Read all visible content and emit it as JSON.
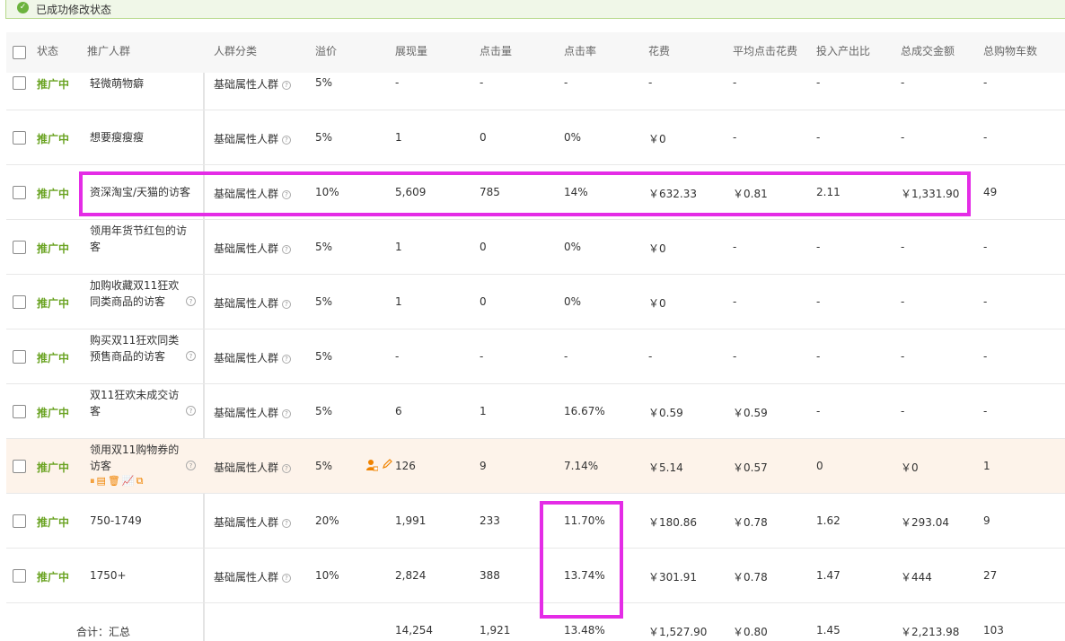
{
  "banner": {
    "message": "已成功修改状态"
  },
  "table": {
    "headers": {
      "status": "状态",
      "crowd": "推广人群",
      "category": "人群分类",
      "premium": "溢价",
      "impressions": "展现量",
      "clicks": "点击量",
      "ctr": "点击率",
      "cost": "花费",
      "avg_cpc": "平均点击花费",
      "roi": "投入产出比",
      "gmv": "总成交金额",
      "carts": "总购物车数"
    },
    "rows": [
      {
        "status": "推广中",
        "name": "轻微萌物癖",
        "category": "基础属性人群",
        "premium": "5%",
        "impressions": "-",
        "clicks": "-",
        "ctr": "-",
        "cost": "-",
        "avg_cpc": "-",
        "roi": "-",
        "gmv": "-",
        "carts": "-"
      },
      {
        "status": "推广中",
        "name": "想要瘦瘦瘦",
        "category": "基础属性人群",
        "premium": "5%",
        "impressions": "1",
        "clicks": "0",
        "ctr": "0%",
        "cost": "￥0",
        "avg_cpc": "-",
        "roi": "-",
        "gmv": "-",
        "carts": "-"
      },
      {
        "status": "推广中",
        "name": "资深淘宝/天猫的访客",
        "category": "基础属性人群",
        "premium": "10%",
        "impressions": "5,609",
        "clicks": "785",
        "ctr": "14%",
        "cost": "￥632.33",
        "avg_cpc": "￥0.81",
        "roi": "2.11",
        "gmv": "￥1,331.90",
        "carts": "49"
      },
      {
        "status": "推广中",
        "name": "领用年货节红包的访客",
        "category": "基础属性人群",
        "premium": "5%",
        "impressions": "1",
        "clicks": "0",
        "ctr": "0%",
        "cost": "￥0",
        "avg_cpc": "-",
        "roi": "-",
        "gmv": "-",
        "carts": "-"
      },
      {
        "status": "推广中",
        "name": "加购收藏双11狂欢同类商品的访客",
        "category": "基础属性人群",
        "premium": "5%",
        "impressions": "1",
        "clicks": "0",
        "ctr": "0%",
        "cost": "￥0",
        "avg_cpc": "-",
        "roi": "-",
        "gmv": "-",
        "carts": "-"
      },
      {
        "status": "推广中",
        "name": "购买双11狂欢同类预售商品的访客",
        "category": "基础属性人群",
        "premium": "5%",
        "impressions": "-",
        "clicks": "-",
        "ctr": "-",
        "cost": "-",
        "avg_cpc": "-",
        "roi": "-",
        "gmv": "-",
        "carts": "-"
      },
      {
        "status": "推广中",
        "name": "双11狂欢未成交访客",
        "category": "基础属性人群",
        "premium": "5%",
        "impressions": "6",
        "clicks": "1",
        "ctr": "16.67%",
        "cost": "￥0.59",
        "avg_cpc": "￥0.59",
        "roi": "-",
        "gmv": "-",
        "carts": "-"
      },
      {
        "status": "推广中",
        "name": "领用双11购物券的访客",
        "category": "基础属性人群",
        "premium": "5%",
        "impressions": "126",
        "clicks": "9",
        "ctr": "7.14%",
        "cost": "￥5.14",
        "avg_cpc": "￥0.57",
        "roi": "0",
        "gmv": "￥0",
        "carts": "1"
      },
      {
        "status": "推广中",
        "name": "750-1749",
        "category": "基础属性人群",
        "premium": "20%",
        "impressions": "1,991",
        "clicks": "233",
        "ctr": "11.70%",
        "cost": "￥180.86",
        "avg_cpc": "￥0.78",
        "roi": "1.62",
        "gmv": "￥293.04",
        "carts": "9"
      },
      {
        "status": "推广中",
        "name": "1750+",
        "category": "基础属性人群",
        "premium": "10%",
        "impressions": "2,824",
        "clicks": "388",
        "ctr": "13.74%",
        "cost": "￥301.91",
        "avg_cpc": "￥0.78",
        "roi": "1.47",
        "gmv": "￥444",
        "carts": "27"
      }
    ],
    "total": {
      "label": "合计：汇总",
      "impressions": "14,254",
      "clicks": "1,921",
      "ctr": "13.48%",
      "cost": "￥1,527.90",
      "avg_cpc": "￥0.80",
      "roi": "1.45",
      "gmv": "￥2,213.98",
      "carts": "103"
    }
  },
  "colors": {
    "status": "#6aa322",
    "highlight_row": "#fdf3ea",
    "annotation": "#e42ce6",
    "action_icons": "#f08300"
  }
}
